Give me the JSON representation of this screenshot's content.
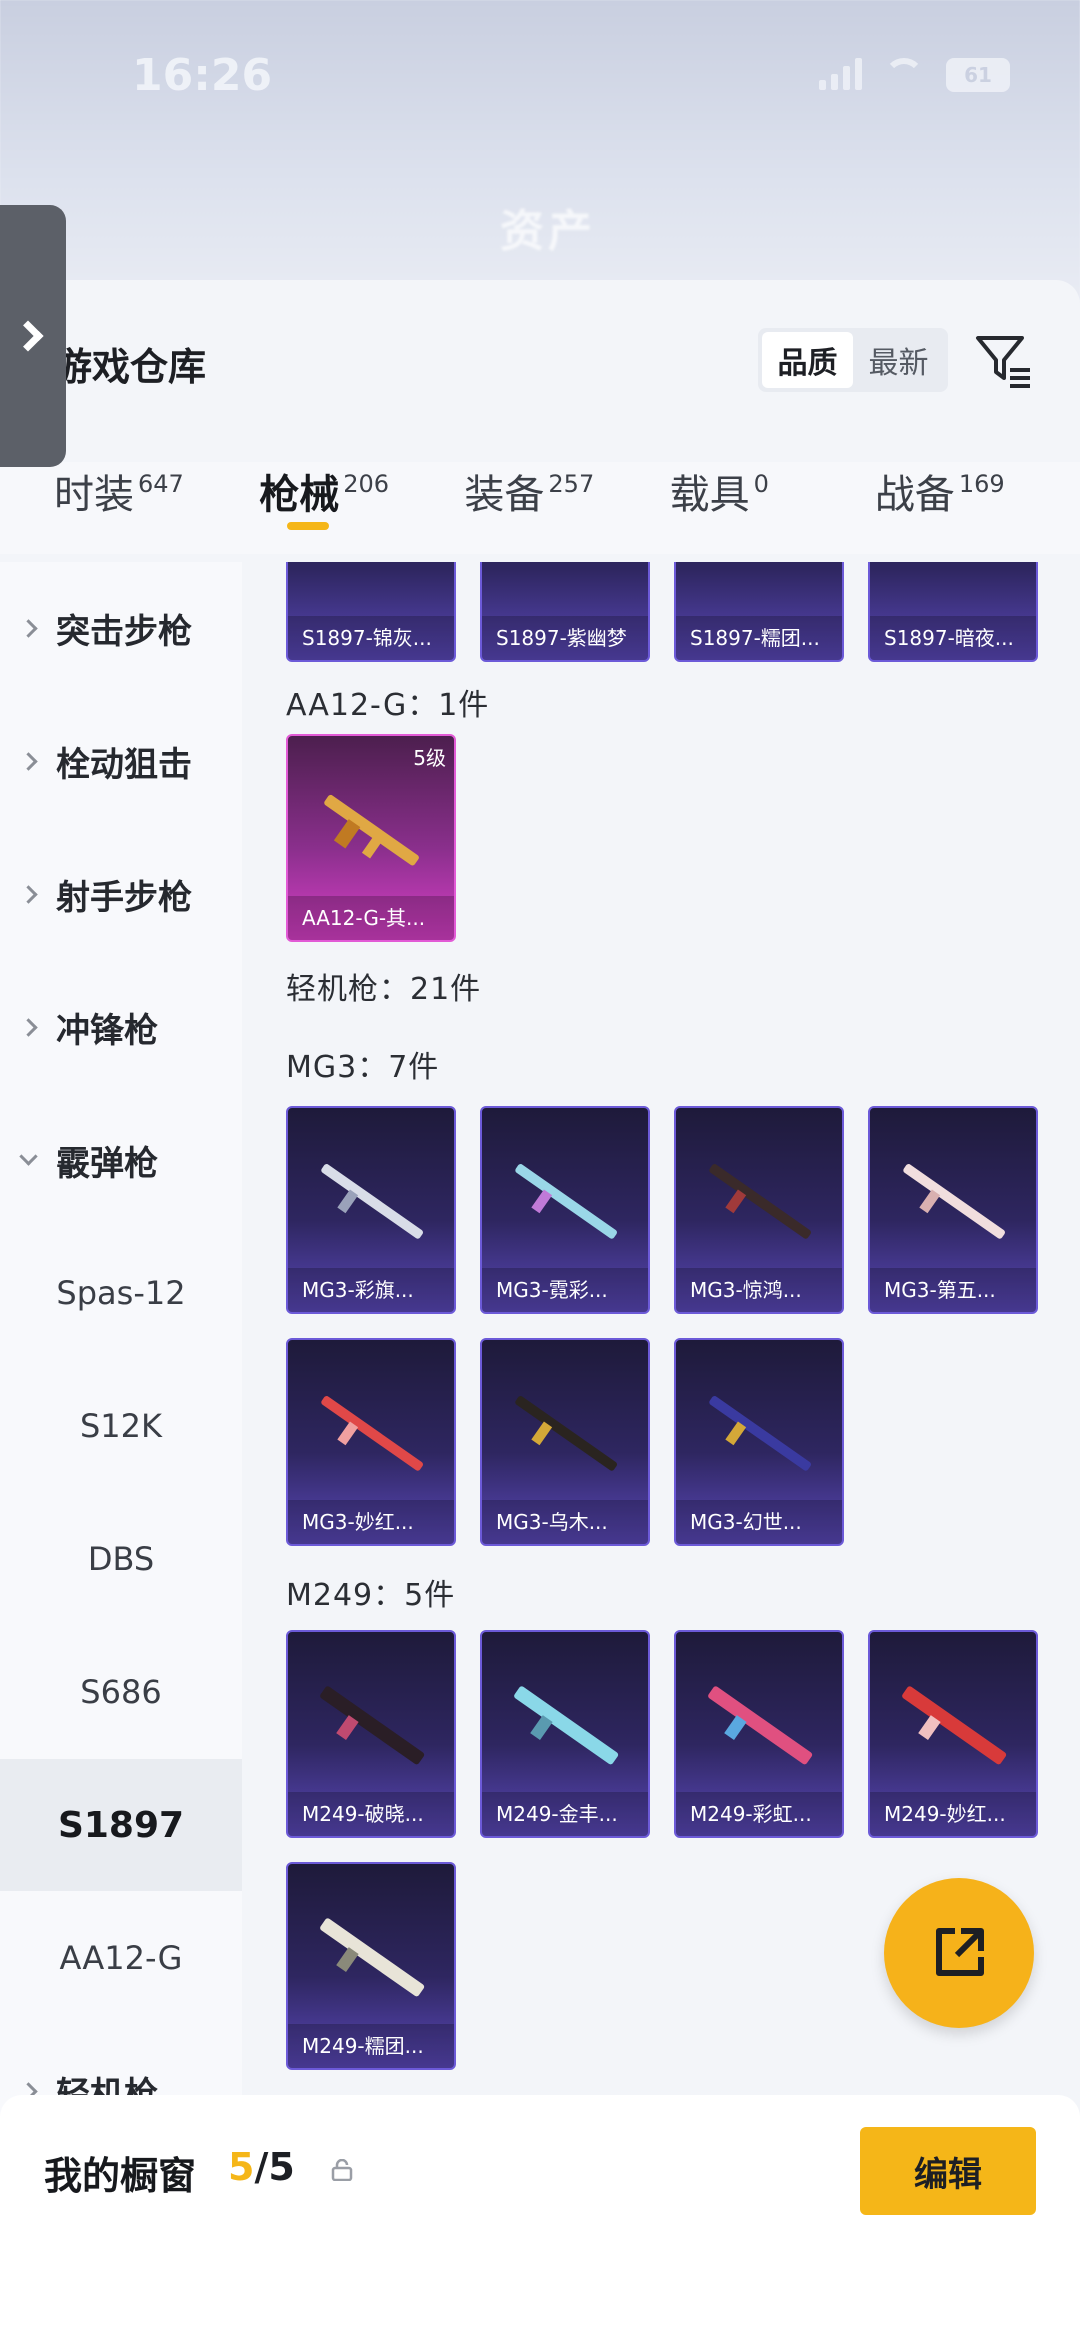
{
  "status": {
    "time": "16:26",
    "battery": "61"
  },
  "blurred_title": "资产",
  "panel": {
    "title": "游戏仓库",
    "sort": [
      "品质",
      "最新"
    ]
  },
  "tabs": [
    {
      "label": "时装",
      "count": "647"
    },
    {
      "label": "枪械",
      "count": "206"
    },
    {
      "label": "装备",
      "count": "257"
    },
    {
      "label": "载具",
      "count": "0"
    },
    {
      "label": "战备",
      "count": "169"
    }
  ],
  "categories": {
    "assault": "突击步枪",
    "bolt": "栓动狙击",
    "marksman": "射手步枪",
    "smg": "冲锋枪",
    "shotgun": "霰弹枪",
    "shotgun_subs": [
      "Spas-12",
      "S12K",
      "DBS",
      "S686",
      "S1897",
      "AA12-G"
    ],
    "lmg": "轻机枪"
  },
  "content": {
    "top_row": [
      "S1897-锦灰...",
      "S1897-紫幽梦",
      "S1897-糯团...",
      "S1897-暗夜..."
    ],
    "aa12_header": "AA12-G：1件",
    "aa12_items": [
      {
        "name": "AA12-G-其...",
        "level": "5级"
      }
    ],
    "lmg_header": "轻机枪：21件",
    "mg3_header": "MG3：7件",
    "mg3_items": [
      "MG3-彩旗...",
      "MG3-霓彩...",
      "MG3-惊鸿...",
      "MG3-第五...",
      "MG3-妙红...",
      "MG3-乌木...",
      "MG3-幻世..."
    ],
    "m249_header": "M249：5件",
    "m249_items": [
      "M249-破晓...",
      "M249-金丰...",
      "M249-彩虹...",
      "M249-妙红...",
      "M249-糯团..."
    ]
  },
  "bottom": {
    "title": "我的橱窗",
    "current": "5",
    "total": "/5",
    "edit": "编辑"
  },
  "colors": {
    "accent": "#f5b618",
    "card_purple": "#5a48b8",
    "card_pink": "#d840c8"
  }
}
